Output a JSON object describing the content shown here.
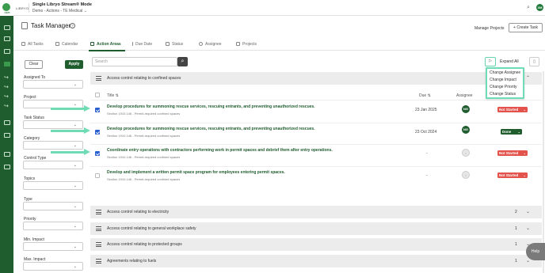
{
  "brand": {
    "logo_text": "CEPI",
    "name": "LIBRYO"
  },
  "header": {
    "mode": "Single Libryo Stream® Mode",
    "context": "Demo - Actions - TE Medical",
    "context_chevron": "⌄",
    "avatar": "XM"
  },
  "page": {
    "title": "Task Manager",
    "help": "?",
    "manage_projects": "Manage Projects",
    "create_task": "Create Task",
    "create_task_icon": "+"
  },
  "tabs": [
    {
      "label": "All Tasks"
    },
    {
      "label": "Calendar"
    },
    {
      "label": "Action Areas"
    },
    {
      "label": "Due Date"
    },
    {
      "label": "Status"
    },
    {
      "label": "Assignee"
    },
    {
      "label": "Projects"
    }
  ],
  "filters": {
    "clear": "Clear",
    "apply": "Apply",
    "fields": [
      {
        "label": "Assigned To"
      },
      {
        "label": "Project"
      },
      {
        "label": "Task Status"
      },
      {
        "label": "Category"
      },
      {
        "label": "Control Type"
      },
      {
        "label": "Topics"
      },
      {
        "label": "Type"
      },
      {
        "label": "Priority"
      },
      {
        "label": "Min. Impact"
      },
      {
        "label": "Max. Impact"
      }
    ]
  },
  "toolbar": {
    "search_placeholder": "Search",
    "expand_all": "Expand All"
  },
  "bulk_menu": {
    "items": [
      "Change Assignee",
      "Change Impact",
      "Change Priority",
      "Change Status"
    ]
  },
  "expanded_group": {
    "label": "Access control relating to confined spaces"
  },
  "table": {
    "col_title": "Title",
    "col_due": "Due",
    "col_assignee": "Assignee",
    "sort_icon": "⇅"
  },
  "tasks": [
    {
      "title": "Develop procedures for summoning rescue services, rescuing entrants, and preventing unauthorized rescues.",
      "sub": "Section 1910.146 - Permit-required confined spaces",
      "due": "23 Jan 2025",
      "assignee": "NG",
      "status": "Not Started",
      "checked": true
    },
    {
      "title": "Develop procedures for summoning rescue services, rescuing entrants, and preventing unauthorized rescues.",
      "sub": "Section 1910.146 - Permit-required confined spaces",
      "due": "23 Oct 2024",
      "assignee": "NG",
      "status": "Done",
      "checked": true
    },
    {
      "title": "Coordinate entry operations with contractors performing work in permit spaces and debrief them after entry operations.",
      "sub": "Section 1910.146 - Permit-required confined spaces",
      "due": "-",
      "assignee": "",
      "status": "Not Started",
      "checked": true
    },
    {
      "title": "Develop and implement a written permit space program for employees entering permit spaces.",
      "sub": "Section 1910.146 - Permit-required confined spaces",
      "due": "-",
      "assignee": "",
      "status": "Not Started",
      "checked": false
    }
  ],
  "groups": [
    {
      "label": "Access control relating to electricity",
      "count": "2"
    },
    {
      "label": "Access control relating to general workplace safety",
      "count": "1"
    },
    {
      "label": "Access control relating to protected groups",
      "count": "1"
    },
    {
      "label": "Agreements relating to fuels",
      "count": "1"
    }
  ],
  "help_bubble": "Help",
  "colors": {
    "brand_green": "#1f5c2e",
    "accent": "#6fdcb5",
    "not_started": "#e3524b"
  }
}
